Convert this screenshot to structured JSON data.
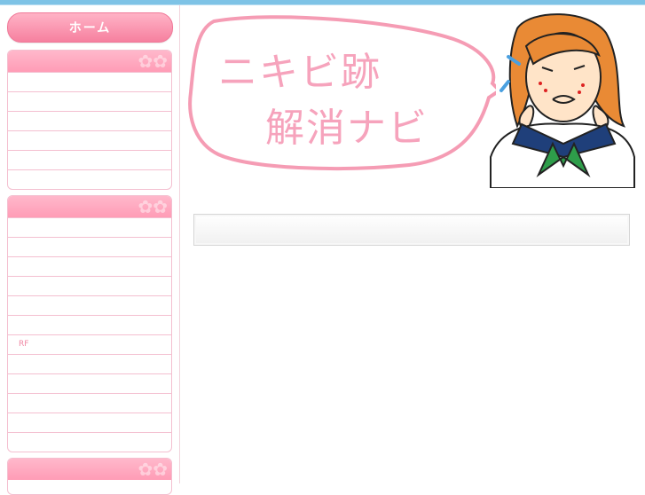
{
  "header": {
    "logo_line1": "ニキビ跡",
    "logo_line2": "解消ナビ"
  },
  "sidebar": {
    "home_label": "ホーム",
    "boxes": [
      {
        "items": [
          "",
          "",
          "",
          "",
          "",
          ""
        ]
      },
      {
        "items": [
          "",
          "",
          "",
          "",
          "",
          "",
          "RF",
          "",
          "",
          "",
          "",
          ""
        ]
      },
      {
        "items": []
      }
    ]
  },
  "colors": {
    "accent_pink": "#ff9cb6",
    "top_bar": "#7ec3e6"
  }
}
